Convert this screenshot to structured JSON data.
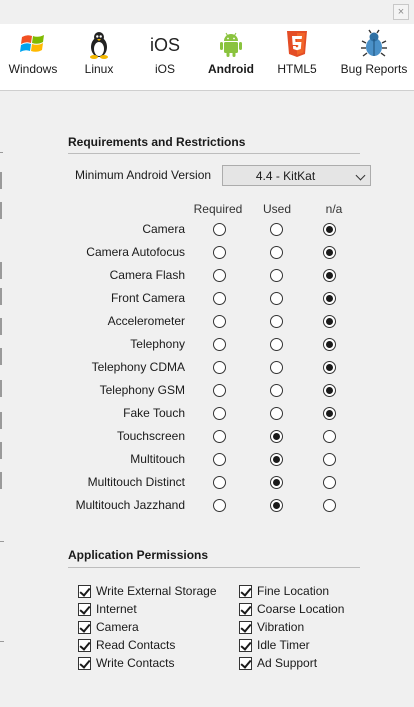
{
  "window": {
    "close_glyph": "×"
  },
  "platforms": [
    {
      "label": "Windows",
      "icon": "windows-icon",
      "active": false
    },
    {
      "label": "Linux",
      "icon": "linux-icon",
      "active": false
    },
    {
      "label": "iOS",
      "icon": "ios-icon",
      "active": false
    },
    {
      "label": "Android",
      "icon": "android-icon",
      "active": true
    },
    {
      "label": "HTML5",
      "icon": "html5-icon",
      "active": false
    },
    {
      "label": "Bug Reports",
      "icon": "bug-icon",
      "active": false
    }
  ],
  "requirements": {
    "title": "Requirements and Restrictions",
    "min_version_label": "Minimum Android Version",
    "min_version_value": "4.4 - KitKat",
    "columns": [
      "Required",
      "Used",
      "n/a"
    ],
    "features": [
      {
        "label": "Camera",
        "selected": "n/a"
      },
      {
        "label": "Camera Autofocus",
        "selected": "n/a"
      },
      {
        "label": "Camera Flash",
        "selected": "n/a"
      },
      {
        "label": "Front Camera",
        "selected": "n/a"
      },
      {
        "label": "Accelerometer",
        "selected": "n/a"
      },
      {
        "label": "Telephony",
        "selected": "n/a"
      },
      {
        "label": "Telephony CDMA",
        "selected": "n/a"
      },
      {
        "label": "Telephony GSM",
        "selected": "n/a"
      },
      {
        "label": "Fake Touch",
        "selected": "n/a"
      },
      {
        "label": "Touchscreen",
        "selected": "Used"
      },
      {
        "label": "Multitouch",
        "selected": "Used"
      },
      {
        "label": "Multitouch Distinct",
        "selected": "Used"
      },
      {
        "label": "Multitouch Jazzhand",
        "selected": "Used"
      }
    ]
  },
  "permissions": {
    "title": "Application Permissions",
    "items": [
      {
        "label": "Write External Storage",
        "checked": true
      },
      {
        "label": "Fine Location",
        "checked": true
      },
      {
        "label": "Internet",
        "checked": true
      },
      {
        "label": "Coarse Location",
        "checked": true
      },
      {
        "label": "Camera",
        "checked": true
      },
      {
        "label": "Vibration",
        "checked": true
      },
      {
        "label": "Read Contacts",
        "checked": true
      },
      {
        "label": "Idle Timer",
        "checked": true
      },
      {
        "label": "Write Contacts",
        "checked": true
      },
      {
        "label": "Ad Support",
        "checked": true
      }
    ]
  },
  "colors": {
    "android_green": "#8ac33e",
    "html5_orange": "#e44d26",
    "bug_blue": "#4a90c8"
  }
}
